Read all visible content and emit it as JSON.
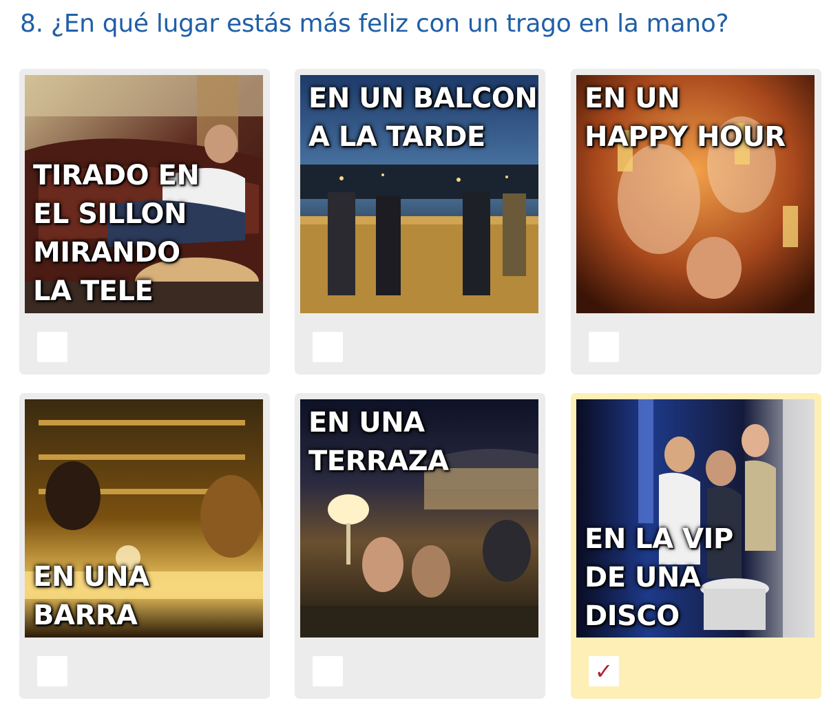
{
  "question": {
    "title": "8. ¿En qué lugar estás más feliz con un trago en la mano?"
  },
  "options": [
    {
      "caption_lines": [
        "TIRADO EN",
        "EL SILLON",
        "MIRANDO",
        "LA TELE"
      ],
      "selected": false
    },
    {
      "caption_lines": [
        "EN UN BALCON",
        "A LA TARDE"
      ],
      "selected": false
    },
    {
      "caption_lines": [
        "EN UN",
        "HAPPY HOUR"
      ],
      "selected": false
    },
    {
      "caption_lines": [
        "EN UNA",
        "BARRA"
      ],
      "selected": false
    },
    {
      "caption_lines": [
        "EN UNA",
        "TERRAZA"
      ],
      "selected": false
    },
    {
      "caption_lines": [
        "EN LA VIP",
        "DE UNA",
        "DISCO"
      ],
      "selected": true,
      "check_glyph": "✓"
    }
  ],
  "colors": {
    "title": "#1f5fa8",
    "card_bg": "#ececec",
    "card_selected_bg": "#fdefb6",
    "check": "#b22030"
  },
  "icons": {
    "check": "checkmark-icon"
  }
}
